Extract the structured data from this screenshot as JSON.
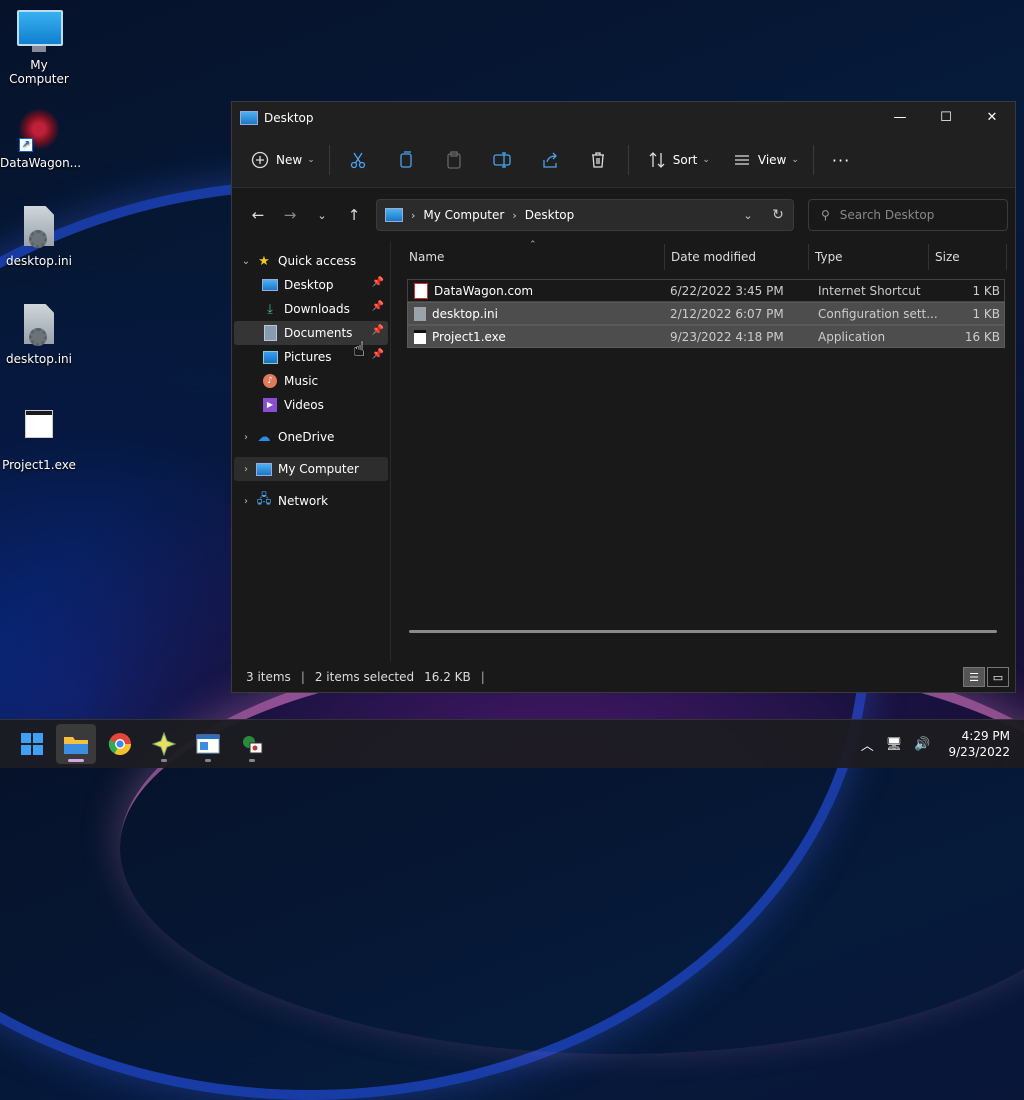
{
  "desktop": {
    "icons": [
      {
        "label": "My Computer",
        "icon": "computer-icon"
      },
      {
        "label": "DataWagon...",
        "icon": "datawagon-shortcut-icon"
      },
      {
        "label": "desktop.ini",
        "icon": "settings-file-icon"
      },
      {
        "label": "desktop.ini",
        "icon": "settings-file-icon"
      },
      {
        "label": "Project1.exe",
        "icon": "application-icon"
      }
    ]
  },
  "window": {
    "title": "Desktop",
    "controls": {
      "minimize": "—",
      "maximize": "☐",
      "close": "✕"
    }
  },
  "command_bar": {
    "new_label": "New",
    "sort_label": "Sort",
    "view_label": "View",
    "more_label": "···"
  },
  "address": {
    "crumbs": [
      "My Computer",
      "Desktop"
    ],
    "search_placeholder": "Search Desktop"
  },
  "nav_pane": {
    "quick_access": "Quick access",
    "quick_items": [
      {
        "label": "Desktop",
        "pinned": true
      },
      {
        "label": "Downloads",
        "pinned": true
      },
      {
        "label": "Documents",
        "pinned": true
      },
      {
        "label": "Pictures",
        "pinned": true
      },
      {
        "label": "Music",
        "pinned": false
      },
      {
        "label": "Videos",
        "pinned": false
      }
    ],
    "onedrive": "OneDrive",
    "my_computer": "My Computer",
    "network": "Network"
  },
  "columns": {
    "name": "Name",
    "date": "Date modified",
    "type": "Type",
    "size": "Size"
  },
  "files": [
    {
      "name": "DataWagon.com",
      "date": "6/22/2022 3:45 PM",
      "type": "Internet Shortcut",
      "size": "1 KB",
      "selected": false
    },
    {
      "name": "desktop.ini",
      "date": "2/12/2022 6:07 PM",
      "type": "Configuration sett...",
      "size": "1 KB",
      "selected": true
    },
    {
      "name": "Project1.exe",
      "date": "9/23/2022 4:18 PM",
      "type": "Application",
      "size": "16 KB",
      "selected": true
    }
  ],
  "status": {
    "count": "3 items",
    "selected": "2 items selected",
    "size": "16.2 KB"
  },
  "taskbar": {
    "time": "4:29 PM",
    "date": "9/23/2022"
  }
}
